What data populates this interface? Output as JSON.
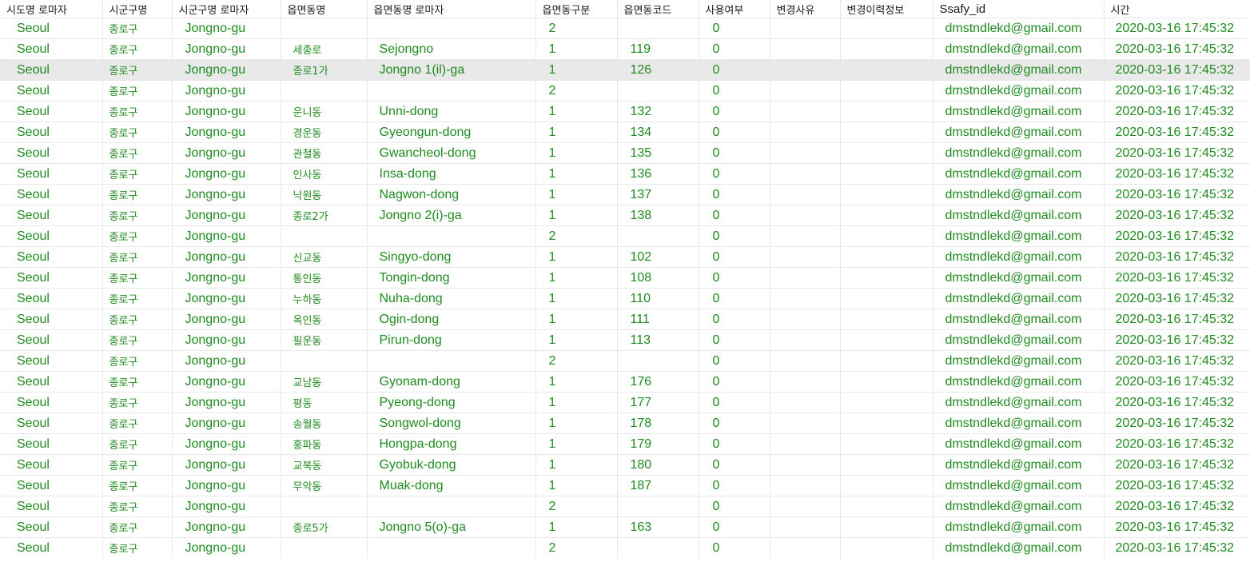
{
  "columns": [
    "시도명 로마자",
    "시군구명",
    "시군구명 로마자",
    "읍면동명",
    "읍면동명 로마자",
    "읍면동구분",
    "읍면동코드",
    "사용여부",
    "변경사유",
    "변경이력정보",
    "Ssafy_id",
    "시간"
  ],
  "selected_row_index": 2,
  "rows": [
    [
      "Seoul",
      "종로구",
      "Jongno-gu",
      "",
      "",
      "2",
      "",
      "0",
      "",
      "",
      "dmstndlekd@gmail.com",
      "2020-03-16 17:45:32"
    ],
    [
      "Seoul",
      "종로구",
      "Jongno-gu",
      "세종로",
      "Sejongno",
      "1",
      "119",
      "0",
      "",
      "",
      "dmstndlekd@gmail.com",
      "2020-03-16 17:45:32"
    ],
    [
      "Seoul",
      "종로구",
      "Jongno-gu",
      "종로1가",
      "Jongno 1(il)-ga",
      "1",
      "126",
      "0",
      "",
      "",
      "dmstndlekd@gmail.com",
      "2020-03-16 17:45:32"
    ],
    [
      "Seoul",
      "종로구",
      "Jongno-gu",
      "",
      "",
      "2",
      "",
      "0",
      "",
      "",
      "dmstndlekd@gmail.com",
      "2020-03-16 17:45:32"
    ],
    [
      "Seoul",
      "종로구",
      "Jongno-gu",
      "운니동",
      "Unni-dong",
      "1",
      "132",
      "0",
      "",
      "",
      "dmstndlekd@gmail.com",
      "2020-03-16 17:45:32"
    ],
    [
      "Seoul",
      "종로구",
      "Jongno-gu",
      "경운동",
      "Gyeongun-dong",
      "1",
      "134",
      "0",
      "",
      "",
      "dmstndlekd@gmail.com",
      "2020-03-16 17:45:32"
    ],
    [
      "Seoul",
      "종로구",
      "Jongno-gu",
      "관철동",
      "Gwancheol-dong",
      "1",
      "135",
      "0",
      "",
      "",
      "dmstndlekd@gmail.com",
      "2020-03-16 17:45:32"
    ],
    [
      "Seoul",
      "종로구",
      "Jongno-gu",
      "인사동",
      "Insa-dong",
      "1",
      "136",
      "0",
      "",
      "",
      "dmstndlekd@gmail.com",
      "2020-03-16 17:45:32"
    ],
    [
      "Seoul",
      "종로구",
      "Jongno-gu",
      "낙원동",
      "Nagwon-dong",
      "1",
      "137",
      "0",
      "",
      "",
      "dmstndlekd@gmail.com",
      "2020-03-16 17:45:32"
    ],
    [
      "Seoul",
      "종로구",
      "Jongno-gu",
      "종로2가",
      "Jongno 2(i)-ga",
      "1",
      "138",
      "0",
      "",
      "",
      "dmstndlekd@gmail.com",
      "2020-03-16 17:45:32"
    ],
    [
      "Seoul",
      "종로구",
      "Jongno-gu",
      "",
      "",
      "2",
      "",
      "0",
      "",
      "",
      "dmstndlekd@gmail.com",
      "2020-03-16 17:45:32"
    ],
    [
      "Seoul",
      "종로구",
      "Jongno-gu",
      "신교동",
      "Singyo-dong",
      "1",
      "102",
      "0",
      "",
      "",
      "dmstndlekd@gmail.com",
      "2020-03-16 17:45:32"
    ],
    [
      "Seoul",
      "종로구",
      "Jongno-gu",
      "통인동",
      "Tongin-dong",
      "1",
      "108",
      "0",
      "",
      "",
      "dmstndlekd@gmail.com",
      "2020-03-16 17:45:32"
    ],
    [
      "Seoul",
      "종로구",
      "Jongno-gu",
      "누하동",
      "Nuha-dong",
      "1",
      "110",
      "0",
      "",
      "",
      "dmstndlekd@gmail.com",
      "2020-03-16 17:45:32"
    ],
    [
      "Seoul",
      "종로구",
      "Jongno-gu",
      "옥인동",
      "Ogin-dong",
      "1",
      "111",
      "0",
      "",
      "",
      "dmstndlekd@gmail.com",
      "2020-03-16 17:45:32"
    ],
    [
      "Seoul",
      "종로구",
      "Jongno-gu",
      "필운동",
      "Pirun-dong",
      "1",
      "113",
      "0",
      "",
      "",
      "dmstndlekd@gmail.com",
      "2020-03-16 17:45:32"
    ],
    [
      "Seoul",
      "종로구",
      "Jongno-gu",
      "",
      "",
      "2",
      "",
      "0",
      "",
      "",
      "dmstndlekd@gmail.com",
      "2020-03-16 17:45:32"
    ],
    [
      "Seoul",
      "종로구",
      "Jongno-gu",
      "교남동",
      "Gyonam-dong",
      "1",
      "176",
      "0",
      "",
      "",
      "dmstndlekd@gmail.com",
      "2020-03-16 17:45:32"
    ],
    [
      "Seoul",
      "종로구",
      "Jongno-gu",
      "평동",
      "Pyeong-dong",
      "1",
      "177",
      "0",
      "",
      "",
      "dmstndlekd@gmail.com",
      "2020-03-16 17:45:32"
    ],
    [
      "Seoul",
      "종로구",
      "Jongno-gu",
      "송월동",
      "Songwol-dong",
      "1",
      "178",
      "0",
      "",
      "",
      "dmstndlekd@gmail.com",
      "2020-03-16 17:45:32"
    ],
    [
      "Seoul",
      "종로구",
      "Jongno-gu",
      "홍파동",
      "Hongpa-dong",
      "1",
      "179",
      "0",
      "",
      "",
      "dmstndlekd@gmail.com",
      "2020-03-16 17:45:32"
    ],
    [
      "Seoul",
      "종로구",
      "Jongno-gu",
      "교북동",
      "Gyobuk-dong",
      "1",
      "180",
      "0",
      "",
      "",
      "dmstndlekd@gmail.com",
      "2020-03-16 17:45:32"
    ],
    [
      "Seoul",
      "종로구",
      "Jongno-gu",
      "무악동",
      "Muak-dong",
      "1",
      "187",
      "0",
      "",
      "",
      "dmstndlekd@gmail.com",
      "2020-03-16 17:45:32"
    ],
    [
      "Seoul",
      "종로구",
      "Jongno-gu",
      "",
      "",
      "2",
      "",
      "0",
      "",
      "",
      "dmstndlekd@gmail.com",
      "2020-03-16 17:45:32"
    ],
    [
      "Seoul",
      "종로구",
      "Jongno-gu",
      "종로5가",
      "Jongno 5(o)-ga",
      "1",
      "163",
      "0",
      "",
      "",
      "dmstndlekd@gmail.com",
      "2020-03-16 17:45:32"
    ],
    [
      "Seoul",
      "종로구",
      "Jongno-gu",
      "",
      "",
      "2",
      "",
      "0",
      "",
      "",
      "dmstndlekd@gmail.com",
      "2020-03-16 17:45:32"
    ]
  ],
  "colors": {
    "cell_text": "#1f8a1f",
    "header_text": "#1a1a1a",
    "selected_row_bg": "#e9e9e9",
    "grid_line": "#e8e8e8"
  }
}
